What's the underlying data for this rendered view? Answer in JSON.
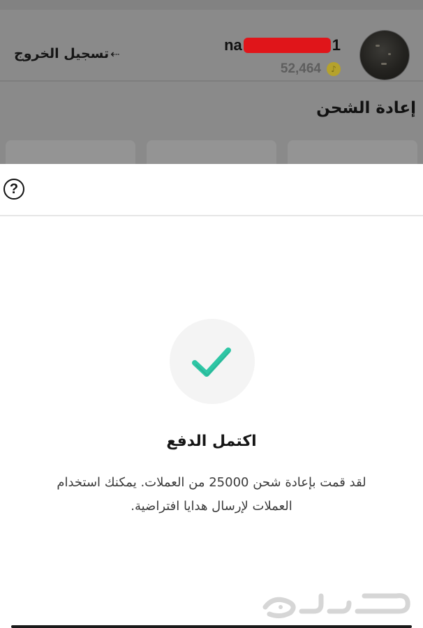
{
  "header": {
    "username_prefix": "na",
    "username_suffix": "1",
    "coin_balance": "52,464",
    "coin_icon": "tiktok-coin-icon",
    "logout_label": "تسجيل الخروج",
    "logout_icon": "logout-arrow-icon"
  },
  "recharge": {
    "title": "إعادة الشحن"
  },
  "modal": {
    "help_icon_label": "?",
    "status_icon": "check-icon",
    "title": "اكتمل الدفع",
    "description_line1": "لقد قمت بإعادة شحن 25000 من العملات. يمكنك استخدام",
    "description_line2": "العملات لإرسال هدايا افتراضية."
  },
  "watermark": {
    "text": "حراج"
  },
  "colors": {
    "redaction": "#e0151a",
    "check": "#2ec6a5",
    "overlay": "#8a8a8a"
  }
}
